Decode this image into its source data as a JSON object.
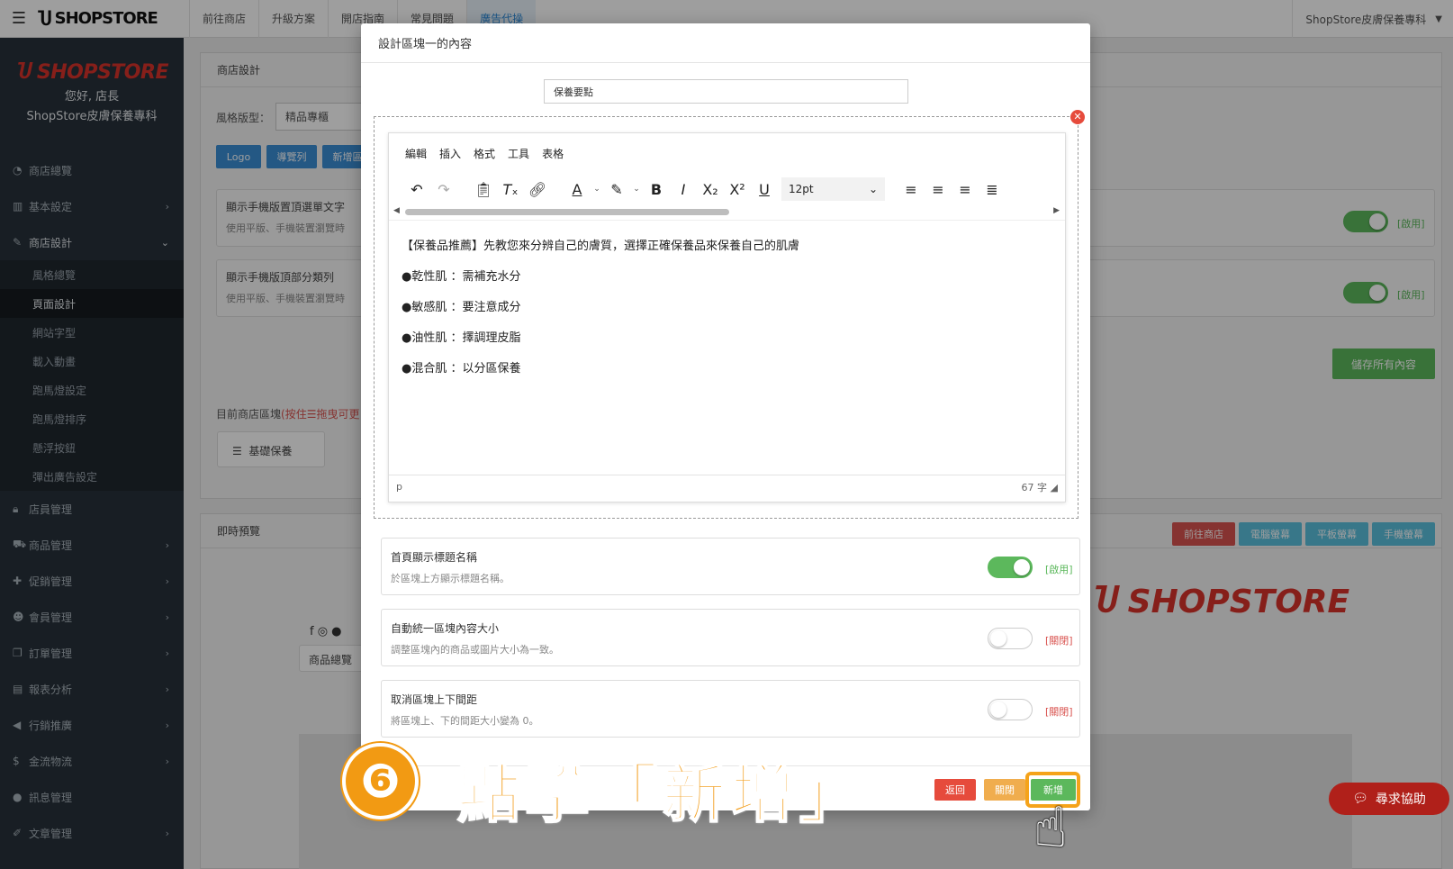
{
  "topbar": {
    "brand": "SHOPSTORE",
    "nav": [
      "前往商店",
      "升級方案",
      "開店指南",
      "常見問題",
      "廣告代操"
    ],
    "active_nav": 4,
    "store_name": "ShopStore皮膚保養專科"
  },
  "sidebar": {
    "logo": "SHOPSTORE",
    "greeting": "您好, 店長",
    "store_name": "ShopStore皮膚保養專科",
    "items": [
      {
        "label": "商店總覽",
        "icon": "dashboard-icon"
      },
      {
        "label": "基本設定",
        "icon": "bank-icon"
      },
      {
        "label": "商店設計",
        "icon": "brush-icon"
      }
    ],
    "subitems": [
      "風格總覽",
      "頁面設計",
      "網站字型",
      "載入動畫",
      "跑馬燈設定",
      "跑馬燈排序",
      "懸浮按鈕",
      "彈出廣告設定"
    ],
    "items_after": [
      {
        "label": "店員管理",
        "icon": "lock-icon"
      },
      {
        "label": "商品管理",
        "icon": "cart-icon"
      },
      {
        "label": "促銷管理",
        "icon": "gift-icon"
      },
      {
        "label": "會員管理",
        "icon": "users-icon"
      },
      {
        "label": "訂單管理",
        "icon": "copy-icon"
      },
      {
        "label": "報表分析",
        "icon": "chart-icon"
      },
      {
        "label": "行銷推廣",
        "icon": "megaphone-icon"
      },
      {
        "label": "金流物流",
        "icon": "dollar-icon"
      },
      {
        "label": "訊息管理",
        "icon": "chat-icon"
      },
      {
        "label": "文章管理",
        "icon": "edit-icon"
      }
    ]
  },
  "background": {
    "panel_title": "商店設計",
    "style_label": "風格版型：",
    "style_value": "精品專櫃",
    "btn_logo": "Logo",
    "btn_nav": "導覽列",
    "btn_add": "新增區",
    "card1_title": "顯示手機版置頂選單文字",
    "card1_desc": "使用平版、手機裝置瀏覽時",
    "card2_title": "顯示手機版頂部分類列",
    "card2_desc": "使用平版、手機裝置瀏覽時",
    "enabled": "[啟用]",
    "save_all": "儲存所有內容",
    "blocks_label": "目前商店區塊",
    "blocks_hint": "(按住☰拖曳可更",
    "block_name": "基礎保養",
    "preview_title": "即時預覽",
    "preview_buttons": [
      "前往商店",
      "電腦螢幕",
      "平板螢幕",
      "手機螢幕"
    ],
    "preview_menu": "商品總覽",
    "preview_logo": "SHOPSTORE"
  },
  "modal": {
    "title": "設計區塊一的內容",
    "name_value": "保養要點",
    "editor": {
      "menu": [
        "編輯",
        "插入",
        "格式",
        "工具",
        "表格"
      ],
      "font_size": "12pt",
      "content": [
        "【保養品推薦】先教您來分辨自己的膚質，選擇正確保養品來保養自己的肌膚",
        "●乾性肌 ：需補充水分",
        "●敏感肌 ：要注意成分",
        "●油性肌 ：擇調理皮脂",
        "●混合肌 ：以分區保養"
      ],
      "status_path": "p",
      "word_count": "67 字"
    },
    "options": [
      {
        "title": "首頁顯示標題名稱",
        "desc": "於區塊上方顯示標題名稱。",
        "state": "[啟用]",
        "on": true
      },
      {
        "title": "自動統一區塊內容大小",
        "desc": "調整區塊內的商品或圖片大小為一致。",
        "state": "[關閉]",
        "on": false
      },
      {
        "title": "取消區塊上下間距",
        "desc": "將區塊上、下的間距大小變為 0。",
        "state": "[關閉]",
        "on": false
      }
    ],
    "buttons": {
      "back": "返回",
      "close": "關閉",
      "add": "新增"
    }
  },
  "annotation": {
    "step_number": "❻",
    "step_text": "點擊「新增」"
  },
  "help": {
    "label": "尋求協助"
  },
  "colors": {
    "sidebar_bg": "#27313a",
    "brand_red": "#d9322b",
    "btn_blue": "#3a8ed6",
    "btn_green": "#5cb85c",
    "btn_red": "#e64b3c",
    "btn_orange": "#f0ad4e",
    "annotation_orange": "#f29a13"
  }
}
